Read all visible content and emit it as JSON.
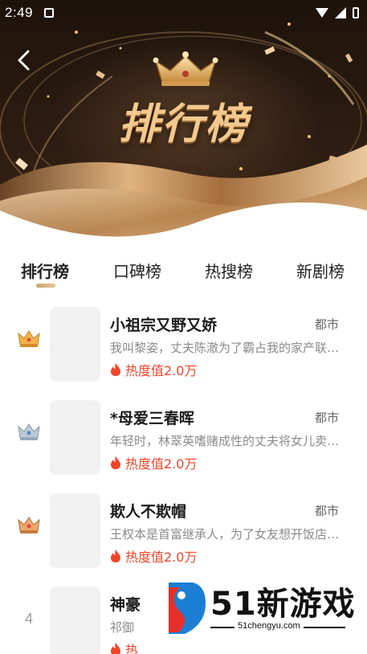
{
  "status_bar": {
    "time": "2:49"
  },
  "header": {
    "title": "排行榜"
  },
  "tabs": [
    {
      "label": "排行榜",
      "active": true
    },
    {
      "label": "口碑榜",
      "active": false
    },
    {
      "label": "热搜榜",
      "active": false
    },
    {
      "label": "新剧榜",
      "active": false
    }
  ],
  "list": [
    {
      "rank": 1,
      "rank_badge": "gold-crown-icon",
      "title": "小祖宗又野又娇",
      "genre": "都市",
      "description": "我叫黎姿，丈夫陈澈为了霸占我的家产联…",
      "heat": "热度值2.0万"
    },
    {
      "rank": 2,
      "rank_badge": "silver-crown-icon",
      "title": "*母爱三春晖",
      "genre": "都市",
      "description": "年轻时，林翠英嗜赌成性的丈夫将女儿卖…",
      "heat": "热度值2.0万"
    },
    {
      "rank": 3,
      "rank_badge": "bronze-crown-icon",
      "title": "欺人不欺帽",
      "genre": "都市",
      "description": "王权本是首富继承人，为了女友想开饭店…",
      "heat": "热度值2.0万"
    },
    {
      "rank": "4",
      "title": "神豪",
      "description": "祁御",
      "heat": "热"
    }
  ],
  "watermark": {
    "brand": "51新游戏",
    "url": "51chengyu.com"
  },
  "colors": {
    "accent_gold": "#e6c791",
    "heat_red": "#f0442a",
    "crown_gold": "#f1b34a",
    "crown_silver": "#a9b8c8",
    "crown_bronze": "#e7a36d"
  }
}
